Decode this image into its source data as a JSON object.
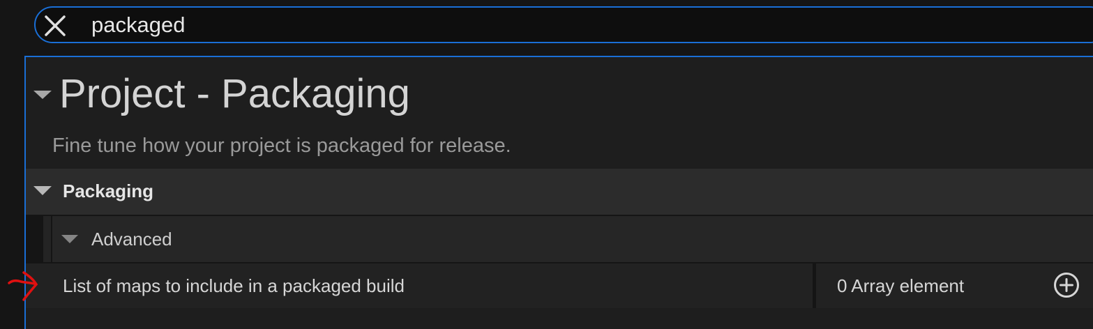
{
  "search": {
    "value": "packaged",
    "clear_icon": "close-icon"
  },
  "panel": {
    "title": "Project - Packaging",
    "subtitle": "Fine tune how your project is packaged for release.",
    "category": {
      "label": "Packaging",
      "expanded": true
    },
    "subcategory": {
      "label": "Advanced",
      "expanded": true
    },
    "property": {
      "name": "List of maps to include in a packaged build",
      "value": "0 Array element",
      "add_icon": "plus-circle-icon"
    }
  },
  "colors": {
    "accent": "#1a6fd6",
    "annotation": "#e01010",
    "background": "#151515"
  }
}
